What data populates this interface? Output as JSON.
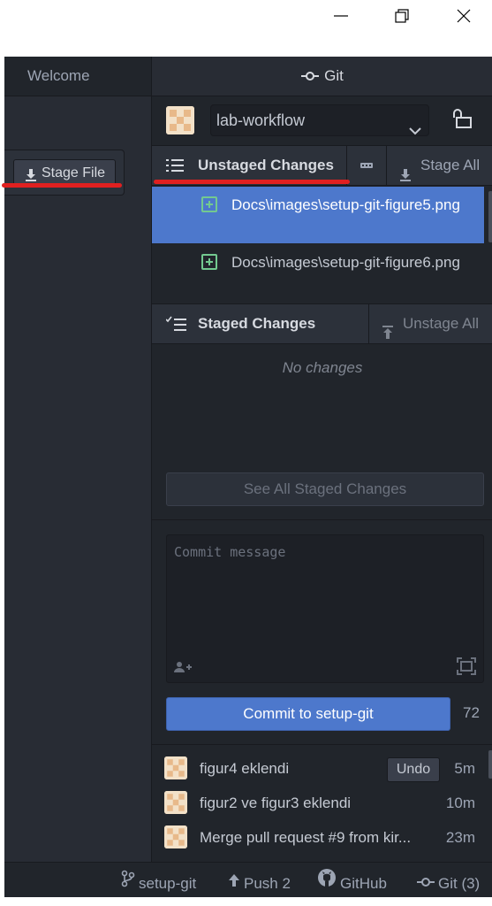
{
  "window": {
    "minimize_icon": "minimize-icon",
    "restore_icon": "restore-icon",
    "close_icon": "close-icon"
  },
  "left_pane": {
    "tab_label": "Welcome",
    "stage_file_label": "Stage File"
  },
  "git_panel": {
    "tab_label": "Git",
    "repo": "lab-workflow",
    "unstaged": {
      "title": "Unstaged Changes",
      "stage_all_label": "Stage All",
      "files": [
        {
          "path": "Docs\\images\\setup-git-figure5.png",
          "status": "added",
          "selected": true
        },
        {
          "path": "Docs\\images\\setup-git-figure6.png",
          "status": "added",
          "selected": false
        }
      ]
    },
    "staged": {
      "title": "Staged Changes",
      "unstage_all_label": "Unstage All",
      "empty_text": "No changes",
      "see_all_label": "See All Staged Changes"
    },
    "commit": {
      "placeholder": "Commit message",
      "button_label": "Commit to setup-git",
      "char_count": "72"
    },
    "recent_commits": [
      {
        "message": "figur4 eklendi",
        "time": "5m",
        "undo_label": "Undo"
      },
      {
        "message": "figur2 ve figur3 eklendi",
        "time": "10m"
      },
      {
        "message": "Merge pull request #9 from kir...",
        "time": "23m"
      }
    ]
  },
  "status_bar": {
    "branch": "setup-git",
    "push": "Push 2",
    "github": "GitHub",
    "git": "Git (3)"
  },
  "colors": {
    "accent": "#4d78cc",
    "added": "#73c990",
    "panel_bg": "#21252b",
    "highlight_underline": "#e02020"
  }
}
